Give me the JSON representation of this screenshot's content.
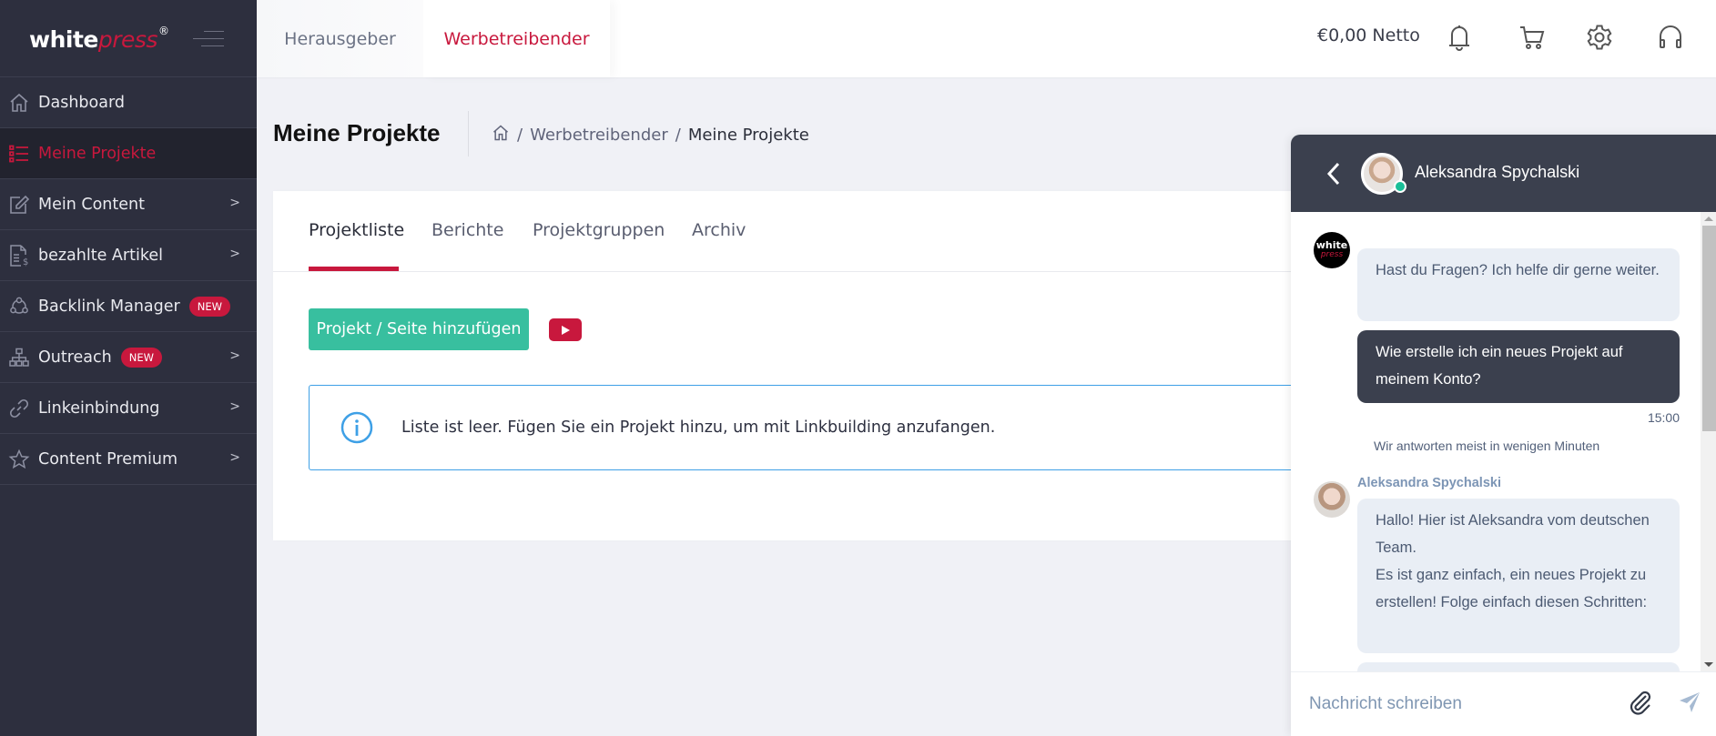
{
  "brand": {
    "name_bold": "white",
    "name_italic": "press",
    "reg": "®"
  },
  "sidebar": {
    "items": [
      {
        "label": "Dashboard",
        "icon": "home-icon",
        "active": false,
        "chevron": false
      },
      {
        "label": "Meine Projekte",
        "icon": "list-icon",
        "active": true,
        "chevron": false
      },
      {
        "label": "Mein Content",
        "icon": "edit-icon",
        "active": false,
        "chevron": true
      },
      {
        "label": "bezahlte Artikel",
        "icon": "paid-article-icon",
        "active": false,
        "chevron": true
      },
      {
        "label": "Backlink Manager",
        "icon": "network-icon",
        "active": false,
        "chevron": false,
        "badge": "NEW"
      },
      {
        "label": "Outreach",
        "icon": "sitemap-icon",
        "active": false,
        "chevron": true,
        "badge": "NEW"
      },
      {
        "label": "Linkeinbindung",
        "icon": "link-icon",
        "active": false,
        "chevron": true
      },
      {
        "label": "Content Premium",
        "icon": "star-icon",
        "active": false,
        "chevron": true
      }
    ],
    "chevron_glyph": ">"
  },
  "topbar": {
    "roles": [
      {
        "label": "Herausgeber",
        "active": false
      },
      {
        "label": "Werbetreibender",
        "active": true
      }
    ],
    "balance": "€0,00 Netto",
    "icons": [
      "bell-icon",
      "cart-icon",
      "gear-icon",
      "headset-icon"
    ]
  },
  "page": {
    "title": "Meine Projekte",
    "breadcrumb": {
      "sep": "/",
      "items": [
        "Werbetreibender",
        "Meine Projekte"
      ]
    }
  },
  "tabs": [
    {
      "label": "Projektliste",
      "active": true
    },
    {
      "label": "Berichte",
      "active": false
    },
    {
      "label": "Projektgruppen",
      "active": false
    },
    {
      "label": "Archiv",
      "active": false
    }
  ],
  "actions": {
    "add_project": "Projekt / Seite hinzufügen"
  },
  "empty_state": {
    "message": "Liste ist leer. Fügen Sie ein Projekt hinzu, um mit Linkbuilding anzufangen."
  },
  "colors": {
    "accent": "#c8183d",
    "primary_button": "#38bf9f",
    "sidebar_bg": "#2d2f3e",
    "info_border": "#3ea0e6",
    "chat_header": "#3b404e"
  },
  "chat": {
    "agent_name": "Aleksandra Spychalski",
    "status": "online",
    "bot_avatar": {
      "line1": "white",
      "line2": "press"
    },
    "messages": [
      {
        "from": "bot",
        "text": "Hast du Fragen? Ich helfe dir gerne weiter."
      },
      {
        "from": "user",
        "text": "Wie erstelle ich ein neues Projekt auf meinem Konto?",
        "time": "15:00"
      },
      {
        "from": "agent",
        "sender": "Aleksandra Spychalski",
        "text": "Hallo! Hier ist Aleksandra vom deutschen Team.\nEs ist ganz einfach, ein neues Projekt zu erstellen! Folge einfach diesen Schritten:"
      }
    ],
    "reply_note": "Wir antworten meist in wenigen Minuten",
    "input_placeholder": "Nachricht schreiben"
  }
}
